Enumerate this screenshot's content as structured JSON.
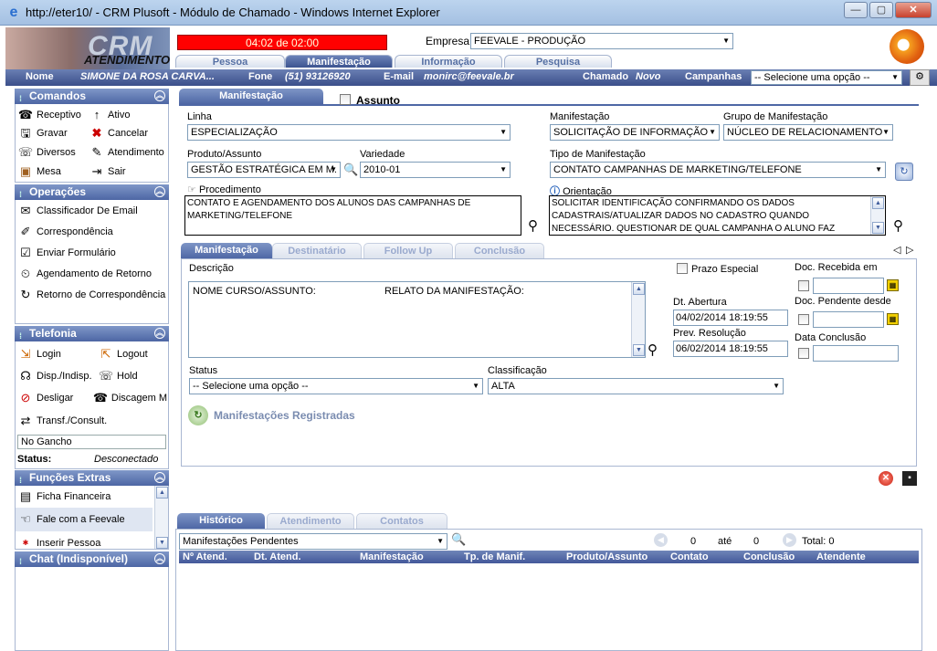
{
  "window": {
    "title": "http://eter10/ - CRM Plusoft - Módulo de Chamado - Windows Internet Explorer"
  },
  "header": {
    "crm_text": "CRM",
    "atendimento_text": "ATENDIMENTO",
    "timer": "04:02 de 02:00",
    "empresa_label": "Empresa:",
    "empresa_value": "FEEVALE - PRODUÇÃO",
    "tabs": [
      "Pessoa",
      "Manifestação",
      "Informação",
      "Pesquisa"
    ]
  },
  "infobar": {
    "nome_label": "Nome",
    "nome_value": "SIMONE DA ROSA CARVA...",
    "fone_label": "Fone",
    "fone_value": "(51) 93126920",
    "email_label": "E-mail",
    "email_value": "monirc@feevale.br",
    "chamado_label": "Chamado",
    "chamado_value": "Novo",
    "campanhas_label": "Campanhas",
    "campanhas_value": "-- Selecione uma opção --"
  },
  "left": {
    "comandos": {
      "title": "Comandos",
      "items": [
        "Receptivo",
        "Ativo",
        "Gravar",
        "Cancelar",
        "Diversos",
        "Atendimento",
        "Mesa",
        "Sair"
      ]
    },
    "operacoes": {
      "title": "Operações",
      "items": [
        "Classificador De Email",
        "Correspondência",
        "Enviar Formulário",
        "Agendamento de Retorno",
        "Retorno de Correspondência"
      ]
    },
    "telefonia": {
      "title": "Telefonia",
      "items": [
        "Login",
        "Logout",
        "Disp./Indisp.",
        "Hold",
        "Desligar",
        "Discagem M",
        "Transf./Consult."
      ],
      "state": "No Gancho",
      "status_label": "Status:",
      "status_value": "Desconectado"
    },
    "funcoes": {
      "title": "Funções Extras",
      "items": [
        "Ficha Financeira",
        "Fale com a Feevale",
        "Inserir Pessoa"
      ]
    },
    "chat": {
      "title": "Chat (Indisponível)"
    }
  },
  "main": {
    "tab_label": "Manifestação",
    "assunto_label": "Assunto",
    "linha_label": "Linha",
    "linha_value": "ESPECIALIZAÇÃO",
    "manifestacao_label": "Manifestação",
    "manifestacao_value": "SOLICITAÇÃO DE INFORMAÇÃO",
    "grupo_label": "Grupo de Manifestação",
    "grupo_value": "NÚCLEO DE RELACIONAMENTO",
    "produto_label": "Produto/Assunto",
    "produto_value": "GESTÃO ESTRATÉGICA EM M.",
    "variedade_label": "Variedade",
    "variedade_value": "2010-01",
    "tipo_label": "Tipo de Manifestação",
    "tipo_value": "CONTATO CAMPANHAS DE MARKETING/TELEFONE",
    "procedimento_label": "Procedimento",
    "procedimento_text": "CONTATO E AGENDAMENTO DOS ALUNOS DAS CAMPANHAS DE MARKETING/TELEFONE",
    "orientacao_label": "Orientação",
    "orientacao_text": "SOLICITAR IDENTIFICAÇÃO CONFIRMANDO OS DADOS CADASTRAIS/ATUALIZAR DADOS NO CADASTRO QUANDO NECESSÁRIO. QUESTIONAR DE QUAL CAMPANHA O ALUNO FAZ",
    "subtabs": [
      "Manifestação",
      "Destinatário",
      "Follow Up",
      "Conclusão"
    ],
    "descricao_label": "Descrição",
    "descricao_col1": "NOME CURSO/ASSUNTO:",
    "descricao_col2": "RELATO DA MANIFESTAÇÃO:",
    "prazo_label": "Prazo Especial",
    "doc_recebida_label": "Doc. Recebida em",
    "doc_pendente_label": "Doc. Pendente desde",
    "data_conclusao_label": "Data Conclusão",
    "dt_abertura_label": "Dt. Abertura",
    "dt_abertura_value": "04/02/2014 18:19:55",
    "prev_resolucao_label": "Prev. Resolução",
    "prev_resolucao_value": "06/02/2014 18:19:55",
    "status_label": "Status",
    "status_value": "-- Selecione uma opção --",
    "classificacao_label": "Classificação",
    "classificacao_value": "ALTA",
    "registradas_label": "Manifestações Registradas"
  },
  "bottom": {
    "tabs": [
      "Histórico",
      "Atendimento",
      "Contatos"
    ],
    "filter_value": "Manifestações Pendentes",
    "page_from": "0",
    "ate_label": "até",
    "page_to": "0",
    "total": "Total: 0",
    "columns": [
      "Nº Atend.",
      "Dt. Atend.",
      "Manifestação",
      "Tp. de Manif.",
      "Produto/Assunto",
      "Contato",
      "Conclusão",
      "Atendente"
    ]
  },
  "colors": {
    "accent": "#4d66a4",
    "timer": "#ff0000"
  }
}
